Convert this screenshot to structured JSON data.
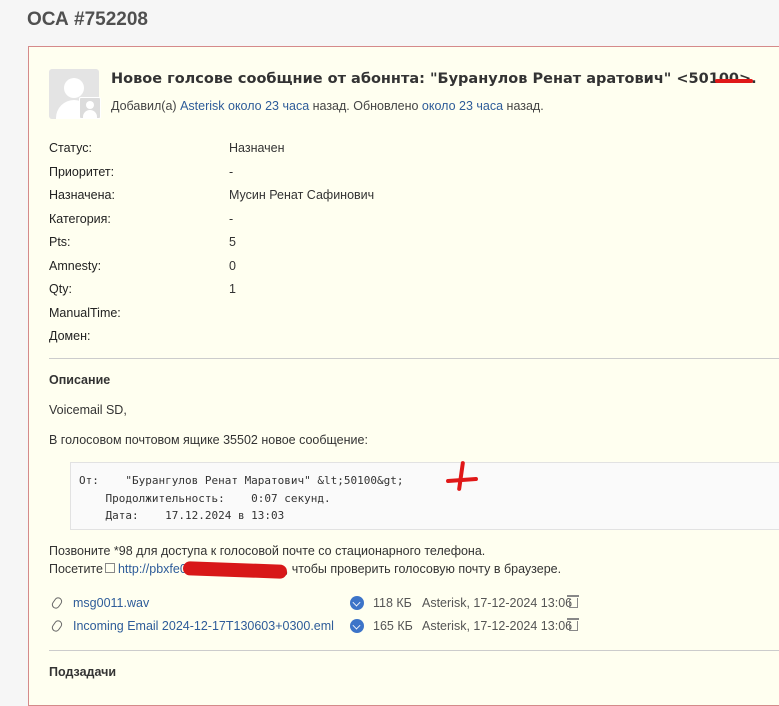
{
  "page_title": "ОСА #752208",
  "issue": {
    "subject": "Новое голсове сообщние от абоннта: \"Буранулов Ренат аратович\" <50100>.",
    "added_by_prefix": "Добавил(а) ",
    "author": "Asterisk",
    "added_time": "около 23 часа",
    "updated_text": " назад. Обновлено ",
    "updated_time": "около 23 часа",
    "suffix": " назад."
  },
  "attributes": [
    {
      "label": "Статус:",
      "value": "Назначен"
    },
    {
      "label": "Приоритет:",
      "value": "-"
    },
    {
      "label": "Назначена:",
      "value": "Мусин Ренат Сафинович"
    },
    {
      "label": "Категория:",
      "value": "-"
    },
    {
      "label": "Pts:",
      "value": "5"
    },
    {
      "label": "Amnesty:",
      "value": "0"
    },
    {
      "label": "Qty:",
      "value": "1"
    },
    {
      "label": "ManualTime:",
      "value": ""
    },
    {
      "label": "Домен:",
      "value": ""
    }
  ],
  "description": {
    "title": "Описание",
    "greeting": "Voicemail SD,",
    "intro": "В голосовом почтовом ящике 35502 новое сообщение:",
    "pre_from": "От:    \"Бурангулов Ренат Маратович\" &lt;50100&gt;",
    "pre_duration": "    Продолжительность:    0:07 секунд.",
    "pre_date": "    Дата:    17.12.2024 в 13:03",
    "call_text": "Позвоните *98 для доступа к голосовой почте со стационарного телефона.",
    "visit_prefix": "Посетите",
    "visit_link": "http://pbxfe0",
    "visit_suffix": ", чтобы проверить голосовую почту в браузере."
  },
  "attachments": [
    {
      "name": "msg0011.wav",
      "size": "118 КБ",
      "meta": "Asterisk, 17-12-2024 13:06"
    },
    {
      "name": "Incoming Email 2024-12-17T130603+0300.eml",
      "size": "165 КБ",
      "meta": "Asterisk, 17-12-2024 13:06"
    }
  ],
  "subtasks_title": "Подзадачи",
  "colors": {
    "link": "#2e5c99",
    "annotation": "#e01818",
    "box_border": "#d58a8a"
  }
}
